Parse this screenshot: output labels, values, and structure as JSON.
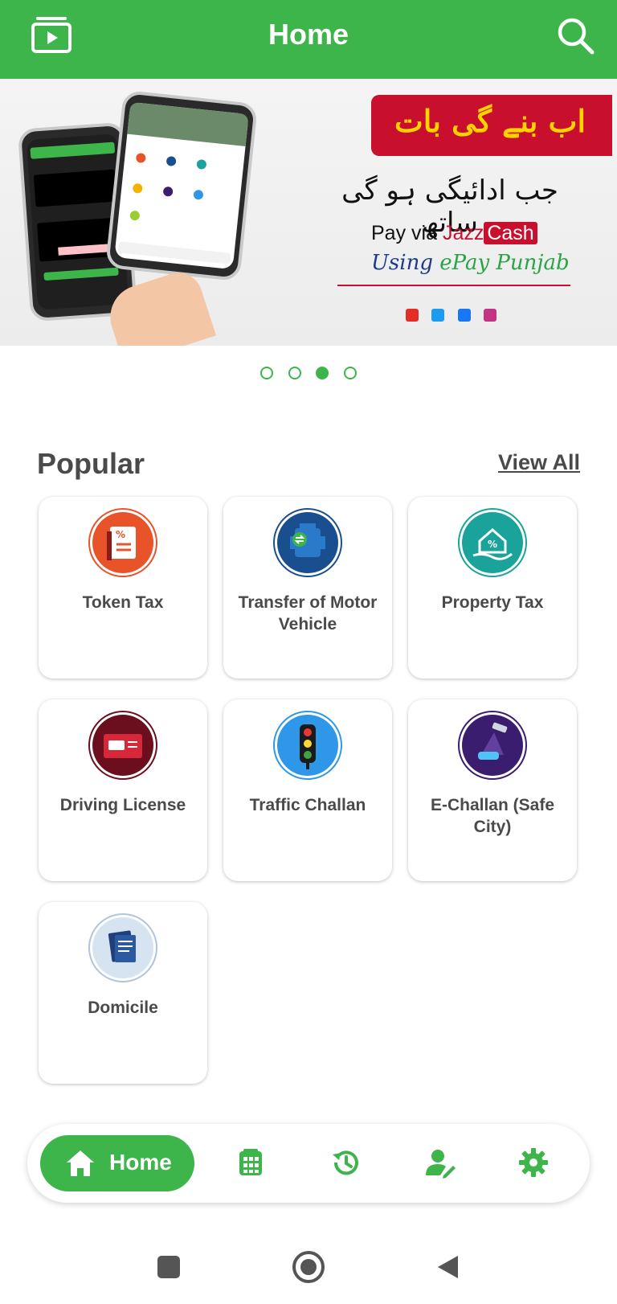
{
  "appbar": {
    "title": "Home",
    "left_icon": "video-library-icon",
    "right_icon": "search-icon"
  },
  "banner": {
    "urdu_tag": "اب بنے گی بات",
    "urdu_line": "جب ادائیگی ہو گی ساتھ",
    "pay_via": "Pay via",
    "jazz": "Jazz",
    "cash": "Cash",
    "using": "Using",
    "epay": "ePay",
    "punjab": "Punjab",
    "carousel_total": 4,
    "carousel_active": 3
  },
  "section": {
    "title": "Popular",
    "view_all": "View All"
  },
  "services": [
    {
      "label": "Token Tax",
      "icon": "token-tax-icon",
      "color": "#e8532a"
    },
    {
      "label": "Transfer of Motor Vehicle",
      "icon": "motor-engine-icon",
      "color": "#1a4f8f"
    },
    {
      "label": "Property Tax",
      "icon": "property-tax-icon",
      "color": "#1aa39a"
    },
    {
      "label": "Driving License",
      "icon": "driving-license-icon",
      "color": "#6b0f1f"
    },
    {
      "label": "Traffic Challan",
      "icon": "traffic-light-icon",
      "color": "#2f97e8"
    },
    {
      "label": "E-Challan (Safe City)",
      "icon": "e-challan-icon",
      "color": "#3a1d6e"
    },
    {
      "label": "Domicile",
      "icon": "domicile-icon",
      "color": "#d6e4f2"
    }
  ],
  "bottom_nav": {
    "home_label": "Home",
    "items": [
      "home-icon",
      "grid-icon",
      "history-icon",
      "profile-edit-icon",
      "settings-icon"
    ],
    "accent": "#3db54a"
  }
}
